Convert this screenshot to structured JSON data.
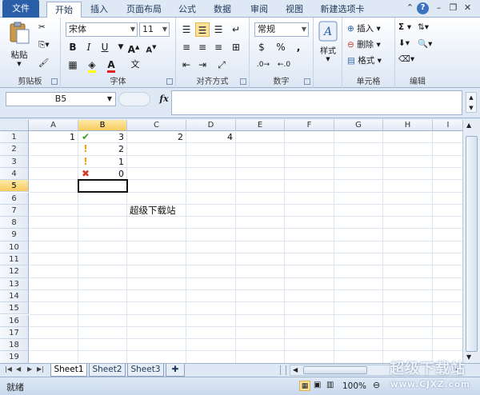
{
  "ribbon_tabs": [
    "文件",
    "开始",
    "插入",
    "页面布局",
    "公式",
    "数据",
    "审阅",
    "视图",
    "新建选项卡"
  ],
  "clipboard": {
    "paste": "粘贴",
    "label": "剪贴板"
  },
  "font": {
    "name": "宋体",
    "size": "11",
    "bold": "B",
    "italic": "I",
    "underline": "U",
    "label": "字体"
  },
  "alignment": {
    "label": "对齐方式"
  },
  "number": {
    "format": "常规",
    "percent": "%",
    "comma": ",",
    "label": "数字"
  },
  "styles": {
    "label": "样式"
  },
  "cells": {
    "insert": "插入",
    "delete": "删除",
    "format": "格式",
    "label": "单元格"
  },
  "editing": {
    "sum": "Σ",
    "label": "编辑"
  },
  "formula_bar": {
    "name_box": "B5",
    "fx": "fx",
    "content": ""
  },
  "columns": [
    "A",
    "B",
    "C",
    "D",
    "E",
    "F",
    "G",
    "H",
    "I"
  ],
  "rows": [
    "1",
    "2",
    "3",
    "4",
    "5",
    "6",
    "7",
    "8",
    "9",
    "10",
    "11",
    "12",
    "13",
    "14",
    "15",
    "16",
    "17",
    "18",
    "19"
  ],
  "cell_values": {
    "A1": "1",
    "B1": "3",
    "C1": "2",
    "D1": "4",
    "B2": "2",
    "B3": "1",
    "B4": "0",
    "C7": "超级下载站"
  },
  "cell_icons": {
    "B1": "check-icon",
    "B2": "exclamation-icon",
    "B3": "exclamation-icon",
    "B4": "cross-icon"
  },
  "icon_colors": {
    "check": "#3a9a2c",
    "exclamation": "#e8a21b",
    "cross": "#d43a2a"
  },
  "sheets": [
    "Sheet1",
    "Sheet2",
    "Sheet3"
  ],
  "status": {
    "ready": "就绪",
    "zoom": "100%"
  },
  "watermark": {
    "brand": "超级下载站",
    "url": "www.CJXZ.com"
  }
}
